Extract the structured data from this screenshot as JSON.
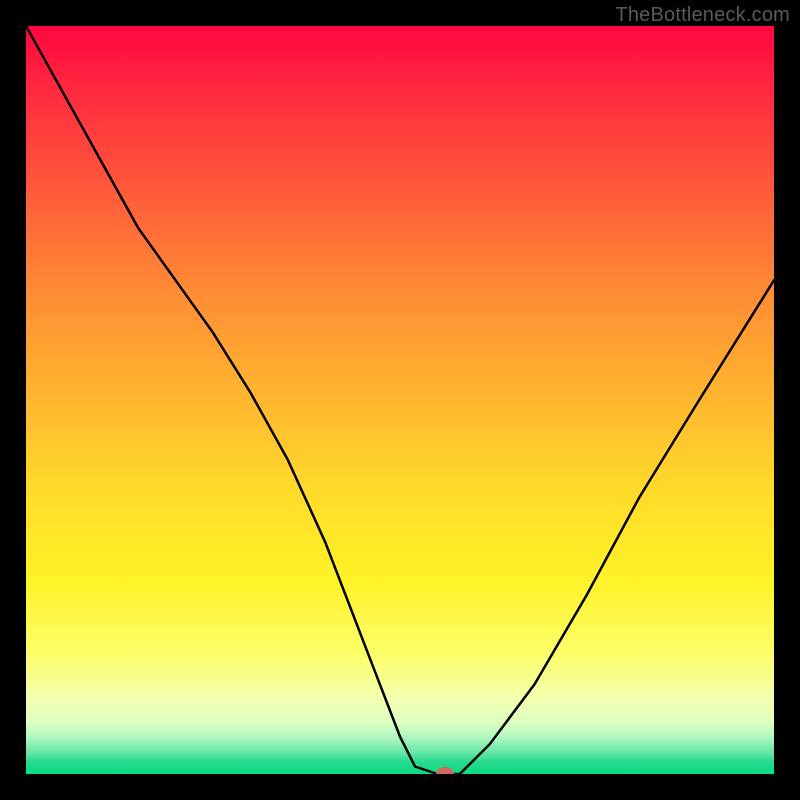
{
  "watermark": "TheBottleneck.com",
  "colors": {
    "page_bg": "#000000",
    "curve": "#000000",
    "marker": "#cf6a60",
    "gradient_top": "#ff0640",
    "gradient_bottom": "#0bdc80",
    "watermark_text": "#5a5a5a"
  },
  "chart_data": {
    "type": "line",
    "title": "",
    "xlabel": "",
    "ylabel": "",
    "xlim": [
      0,
      100
    ],
    "ylim": [
      0,
      100
    ],
    "grid": false,
    "legend": false,
    "notes": "V-shaped bottleneck curve on red→green vertical gradient. Both axes unlabeled. Minimum near x≈55 where y≈0. Gradient encodes bottleneck severity: red high, green low.",
    "series": [
      {
        "name": "bottleneck-curve",
        "x": [
          0,
          5,
          10,
          15,
          20,
          25,
          30,
          35,
          40,
          45,
          50,
          52,
          55,
          58,
          62,
          68,
          75,
          82,
          90,
          100
        ],
        "y": [
          100,
          91,
          82,
          73,
          66,
          59,
          51,
          42,
          31,
          18,
          5,
          1,
          0,
          0,
          4,
          12,
          24,
          37,
          50,
          66
        ]
      }
    ],
    "marker": {
      "x": 56,
      "y": 0
    }
  }
}
